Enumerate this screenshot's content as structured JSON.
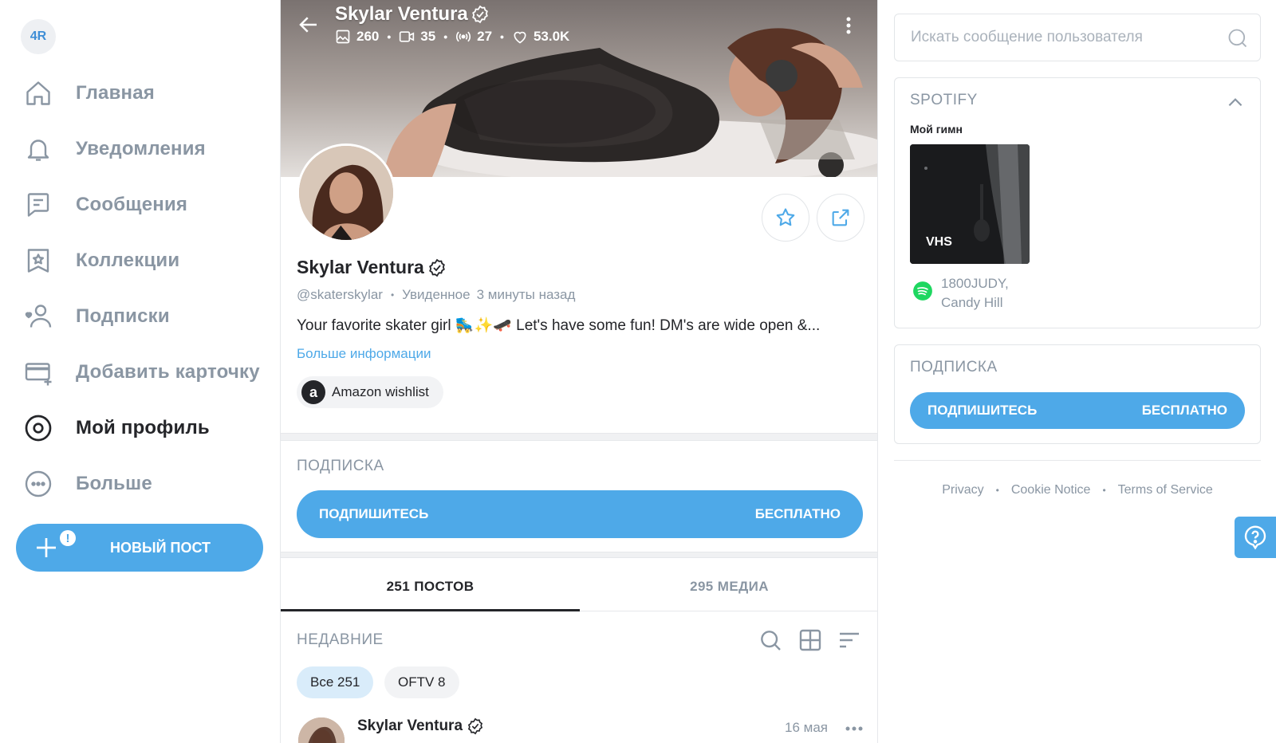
{
  "sidebar": {
    "avatar_initials": "4R",
    "items": [
      {
        "label": "Главная",
        "icon": "home-icon"
      },
      {
        "label": "Уведомления",
        "icon": "bell-icon"
      },
      {
        "label": "Сообщения",
        "icon": "message-icon"
      },
      {
        "label": "Коллекции",
        "icon": "collections-icon"
      },
      {
        "label": "Подписки",
        "icon": "subscriptions-icon"
      },
      {
        "label": "Добавить карточку",
        "icon": "add-card-icon"
      },
      {
        "label": "Мой профиль",
        "icon": "profile-icon",
        "active": true
      },
      {
        "label": "Больше",
        "icon": "more-icon"
      }
    ],
    "new_post_label": "НОВЫЙ ПОСТ",
    "new_post_badge": "!"
  },
  "profile": {
    "name": "Skylar Ventura",
    "stats": {
      "photos": "260",
      "videos": "35",
      "streams": "27",
      "likes": "53.0K"
    },
    "handle": "@skaterskylar",
    "seen_label": "Увиденное",
    "seen_time": "3 минуты назад",
    "bio": "Your favorite skater girl 🛼✨🛹 Let's have some fun! DM's are wide open &...",
    "more_info": "Больше информации",
    "wishlist_icon_letter": "a",
    "wishlist_label": "Amazon wishlist"
  },
  "subscription": {
    "title": "ПОДПИСКА",
    "button_left": "ПОДПИШИТЕСЬ",
    "button_right": "БЕСПЛАТНО"
  },
  "tabs": [
    {
      "label": "251 ПОСТОВ",
      "active": true
    },
    {
      "label": "295 МЕДИА",
      "active": false
    }
  ],
  "feed": {
    "title": "НЕДАВНИЕ",
    "chips": [
      {
        "label": "Все 251",
        "active": true
      },
      {
        "label": "OFTV 8",
        "active": false
      }
    ],
    "post": {
      "author": "Skylar Ventura",
      "date": "16 мая"
    }
  },
  "right": {
    "search_placeholder": "Искать сообщение пользователя",
    "spotify": {
      "title": "SPOTIFY",
      "anthem_label": "Мой гимн",
      "album_label": "VHS",
      "artist": "1800JUDY,",
      "track": "Candy Hill"
    },
    "subscription": {
      "title": "ПОДПИСКА",
      "button_left": "ПОДПИШИТЕСЬ",
      "button_right": "БЕСПЛАТНО"
    },
    "footer": [
      "Privacy",
      "Cookie Notice",
      "Terms of Service"
    ]
  },
  "colors": {
    "accent": "#4ea9e8",
    "muted": "#8a96a3",
    "text": "#242529",
    "spotify": "#1ed760"
  }
}
